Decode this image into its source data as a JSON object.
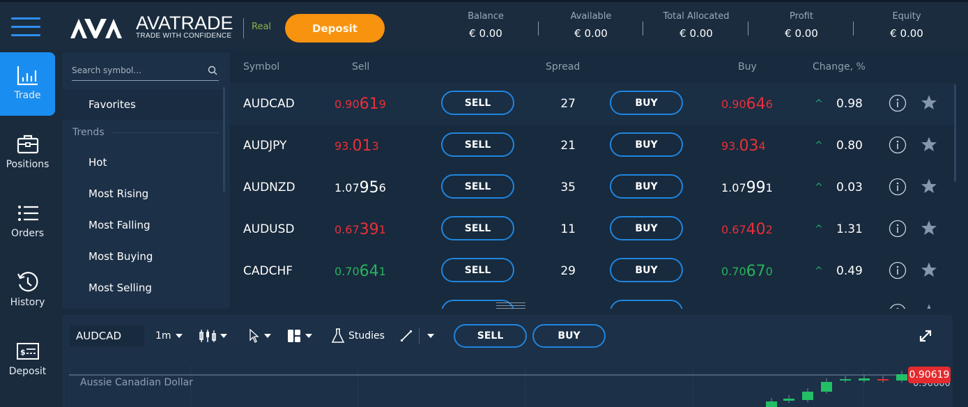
{
  "header": {
    "brand_name": "AVATRADE",
    "brand_tagline": "TRADE WITH CONFIDENCE",
    "account_mode": "Real",
    "deposit_label": "Deposit",
    "stats": [
      {
        "label": "Balance",
        "value": "€ 0.00"
      },
      {
        "label": "Available",
        "value": "€ 0.00"
      },
      {
        "label": "Total Allocated",
        "value": "€ 0.00"
      },
      {
        "label": "Profit",
        "value": "€ 0.00"
      },
      {
        "label": "Equity",
        "value": "€ 0.00"
      }
    ]
  },
  "nav": {
    "items": [
      {
        "label": "Trade",
        "icon": "bar-chart-icon",
        "active": true
      },
      {
        "label": "Positions",
        "icon": "briefcase-icon"
      },
      {
        "label": "Orders",
        "icon": "list-icon"
      },
      {
        "label": "History",
        "icon": "history-icon"
      },
      {
        "label": "Deposit",
        "icon": "deposit-icon"
      }
    ]
  },
  "categories": {
    "search_placeholder": "Search symbol...",
    "favorites_label": "Favorites",
    "section_label": "Trends",
    "items": [
      "Hot",
      "Most Rising",
      "Most Falling",
      "Most Buying",
      "Most Selling"
    ]
  },
  "table": {
    "headers": {
      "symbol": "Symbol",
      "sell": "Sell",
      "spread": "Spread",
      "buy": "Buy",
      "change": "Change, %"
    },
    "sell_button_label": "SELL",
    "buy_button_label": "BUY",
    "rows": [
      {
        "symbol": "AUDCAD",
        "sell_pre": "0.90",
        "sell_big": "61",
        "sell_post": "9",
        "sell_color": "red",
        "spread": "27",
        "buy_pre": "0.90",
        "buy_big": "64",
        "buy_post": "6",
        "buy_color": "red",
        "change_dir": "up",
        "change": "0.98"
      },
      {
        "symbol": "AUDJPY",
        "sell_pre": "93.",
        "sell_big": "01",
        "sell_post": "3",
        "sell_color": "red",
        "spread": "21",
        "buy_pre": "93.",
        "buy_big": "03",
        "buy_post": "4",
        "buy_color": "red",
        "change_dir": "up",
        "change": "0.80"
      },
      {
        "symbol": "AUDNZD",
        "sell_pre": "1.07",
        "sell_big": "95",
        "sell_post": "6",
        "sell_color": "white",
        "spread": "35",
        "buy_pre": "1.07",
        "buy_big": "99",
        "buy_post": "1",
        "buy_color": "white",
        "change_dir": "up",
        "change": "0.03"
      },
      {
        "symbol": "AUDUSD",
        "sell_pre": "0.67",
        "sell_big": "39",
        "sell_post": "1",
        "sell_color": "red",
        "spread": "11",
        "buy_pre": "0.67",
        "buy_big": "40",
        "buy_post": "2",
        "buy_color": "red",
        "change_dir": "up",
        "change": "1.31"
      },
      {
        "symbol": "CADCHF",
        "sell_pre": "0.70",
        "sell_big": "64",
        "sell_post": "1",
        "sell_color": "green",
        "spread": "29",
        "buy_pre": "0.70",
        "buy_big": "67",
        "buy_post": "0",
        "buy_color": "green",
        "change_dir": "up",
        "change": "0.49"
      }
    ]
  },
  "chart": {
    "symbol": "AUDCAD",
    "timeframe": "1m",
    "studies_label": "Studies",
    "sell_label": "SELL",
    "buy_label": "BUY",
    "instrument_name": "Aussie Canadian Dollar",
    "current_price": "0.90619",
    "axis_label": "0.90600"
  }
}
